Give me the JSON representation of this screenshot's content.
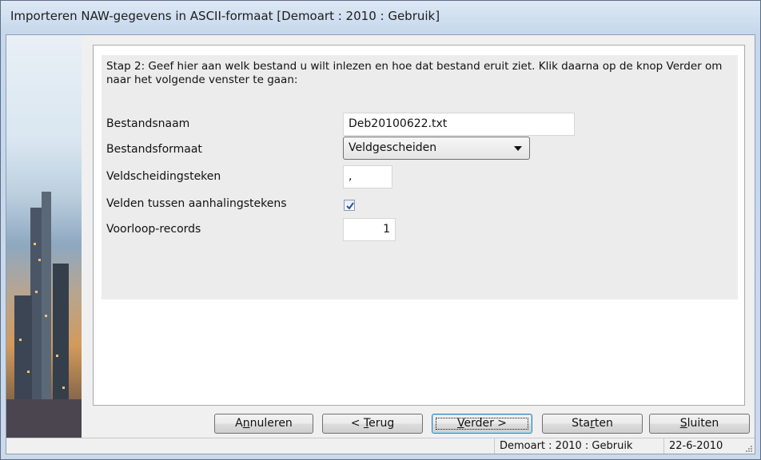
{
  "window": {
    "title": "Importeren NAW-gegevens in ASCII-formaat  [Demoart : 2010 : Gebruik]"
  },
  "form": {
    "intro": "Stap 2: Geef hier aan welk bestand u wilt inlezen en hoe dat bestand eruit ziet. Klik daarna op de knop Verder om naar het volgende venster te gaan:",
    "bestandsnaam_label": "Bestandsnaam",
    "bestandsnaam_value": "Deb20100622.txt",
    "bestandsformaat_label": "Bestandsformaat",
    "bestandsformaat_value": "Veldgescheiden",
    "veldscheidingsteken_label": "Veldscheidingsteken",
    "veldscheidingsteken_value": ",",
    "aanhalingstekens_label": "Velden tussen aanhalingstekens",
    "aanhalingstekens_checked": true,
    "voorloop_label": "Voorloop-records",
    "voorloop_value": "1"
  },
  "buttons": {
    "annuleren": {
      "pre": "A",
      "key": "n",
      "post": "nuleren"
    },
    "terug": {
      "pre": "< ",
      "key": "T",
      "post": "erug"
    },
    "verder": {
      "pre": "",
      "key": "V",
      "post": "erder >"
    },
    "starten": {
      "pre": "Sta",
      "key": "r",
      "post": "ten"
    },
    "sluiten": {
      "pre": "",
      "key": "S",
      "post": "luiten"
    }
  },
  "status": {
    "context": "Demoart : 2010 : Gebruik",
    "date": "22-6-2010"
  },
  "colors": {
    "accent": "#3c7fb1",
    "panel_bg": "#ececec"
  }
}
